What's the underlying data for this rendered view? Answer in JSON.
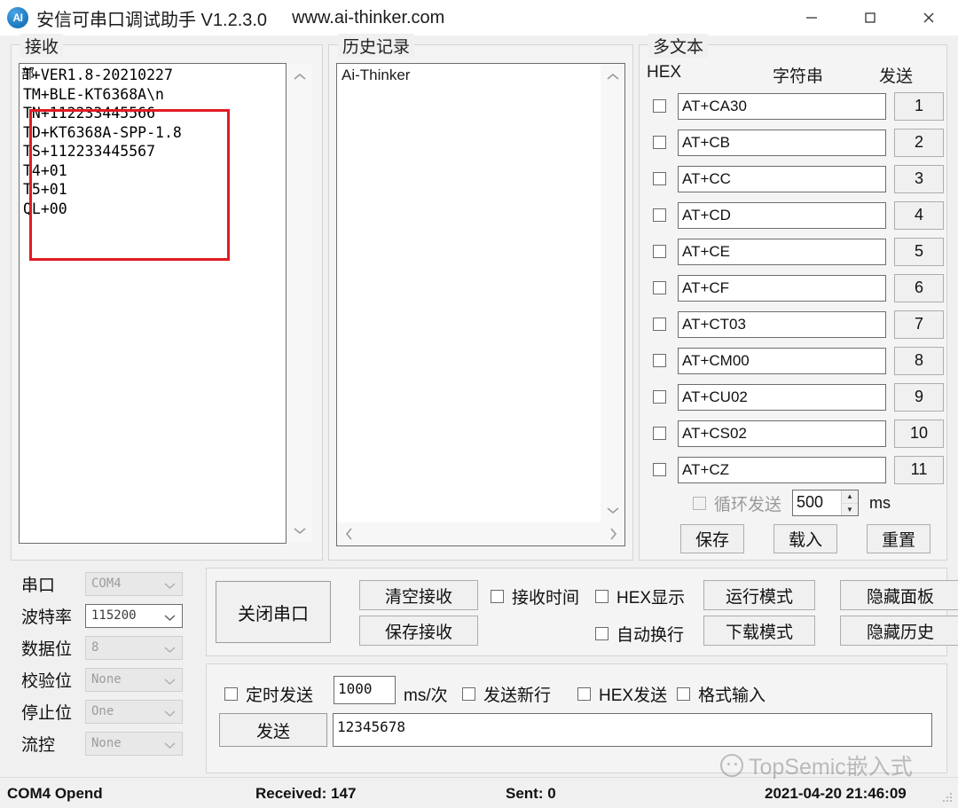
{
  "window": {
    "title": "安信可串口调试助手 V1.2.3.0",
    "url": "www.ai-thinker.com",
    "icon_label": "AI",
    "minimize": "minimize-icon",
    "maximize": "maximize-icon",
    "close": "close-icon"
  },
  "receive": {
    "legend": "接收",
    "overlap_char": "部",
    "lines": [
      "T+VER1.8-20210227",
      "TM+BLE-KT6368A\\n",
      "TN+112233445566",
      "TD+KT6368A-SPP-1.8",
      "TS+112233445567",
      "T4+01",
      "T5+01",
      "QL+00"
    ],
    "annotation_color": "#e01b24"
  },
  "history": {
    "legend": "历史记录",
    "text": "Ai-Thinker"
  },
  "multitext": {
    "legend": "多文本",
    "col_hex": "HEX",
    "col_string": "字符串",
    "col_send": "发送",
    "rows": [
      {
        "checked": false,
        "value": "AT+CA30",
        "send": "1"
      },
      {
        "checked": false,
        "value": "AT+CB",
        "send": "2"
      },
      {
        "checked": false,
        "value": "AT+CC",
        "send": "3"
      },
      {
        "checked": false,
        "value": "AT+CD",
        "send": "4"
      },
      {
        "checked": false,
        "value": "AT+CE",
        "send": "5"
      },
      {
        "checked": false,
        "value": "AT+CF",
        "send": "6"
      },
      {
        "checked": false,
        "value": "AT+CT03",
        "send": "7"
      },
      {
        "checked": false,
        "value": "AT+CM00",
        "send": "8"
      },
      {
        "checked": false,
        "value": "AT+CU02",
        "send": "9"
      },
      {
        "checked": false,
        "value": "AT+CS02",
        "send": "10"
      },
      {
        "checked": false,
        "value": "AT+CZ",
        "send": "11"
      }
    ],
    "cyclic_label": "循环发送",
    "cyclic_interval": "500",
    "cyclic_unit": "ms",
    "save": "保存",
    "load": "载入",
    "reset": "重置"
  },
  "serial": {
    "rows": [
      {
        "label": "串口",
        "value": "COM4",
        "enabled": false
      },
      {
        "label": "波特率",
        "value": "115200",
        "enabled": true
      },
      {
        "label": "数据位",
        "value": "8",
        "enabled": false
      },
      {
        "label": "校验位",
        "value": "None",
        "enabled": false
      },
      {
        "label": "停止位",
        "value": "One",
        "enabled": false
      },
      {
        "label": "流控",
        "value": "None",
        "enabled": false
      }
    ]
  },
  "controls": {
    "open_close": "关闭串口",
    "clear_recv": "清空接收",
    "save_recv": "保存接收",
    "recv_time_label": "接收时间",
    "hex_display_label": "HEX显示",
    "auto_newline_label": "自动换行",
    "run_mode": "运行模式",
    "download_mode": "下载模式",
    "hide_panel": "隐藏面板",
    "hide_history": "隐藏历史"
  },
  "send": {
    "timed_send_label": "定时发送",
    "timer_value": "1000",
    "timer_unit": "ms/次",
    "send_newline_label": "发送新行",
    "hex_send_label": "HEX发送",
    "format_input_label": "格式输入",
    "send_button": "发送",
    "input_value": "12345678"
  },
  "watermark": {
    "text": "TopSemic嵌入式"
  },
  "status": {
    "port": "COM4 Opend",
    "received": "Received: 147",
    "sent": "Sent: 0",
    "datetime": "2021-04-20 21:46:09"
  }
}
